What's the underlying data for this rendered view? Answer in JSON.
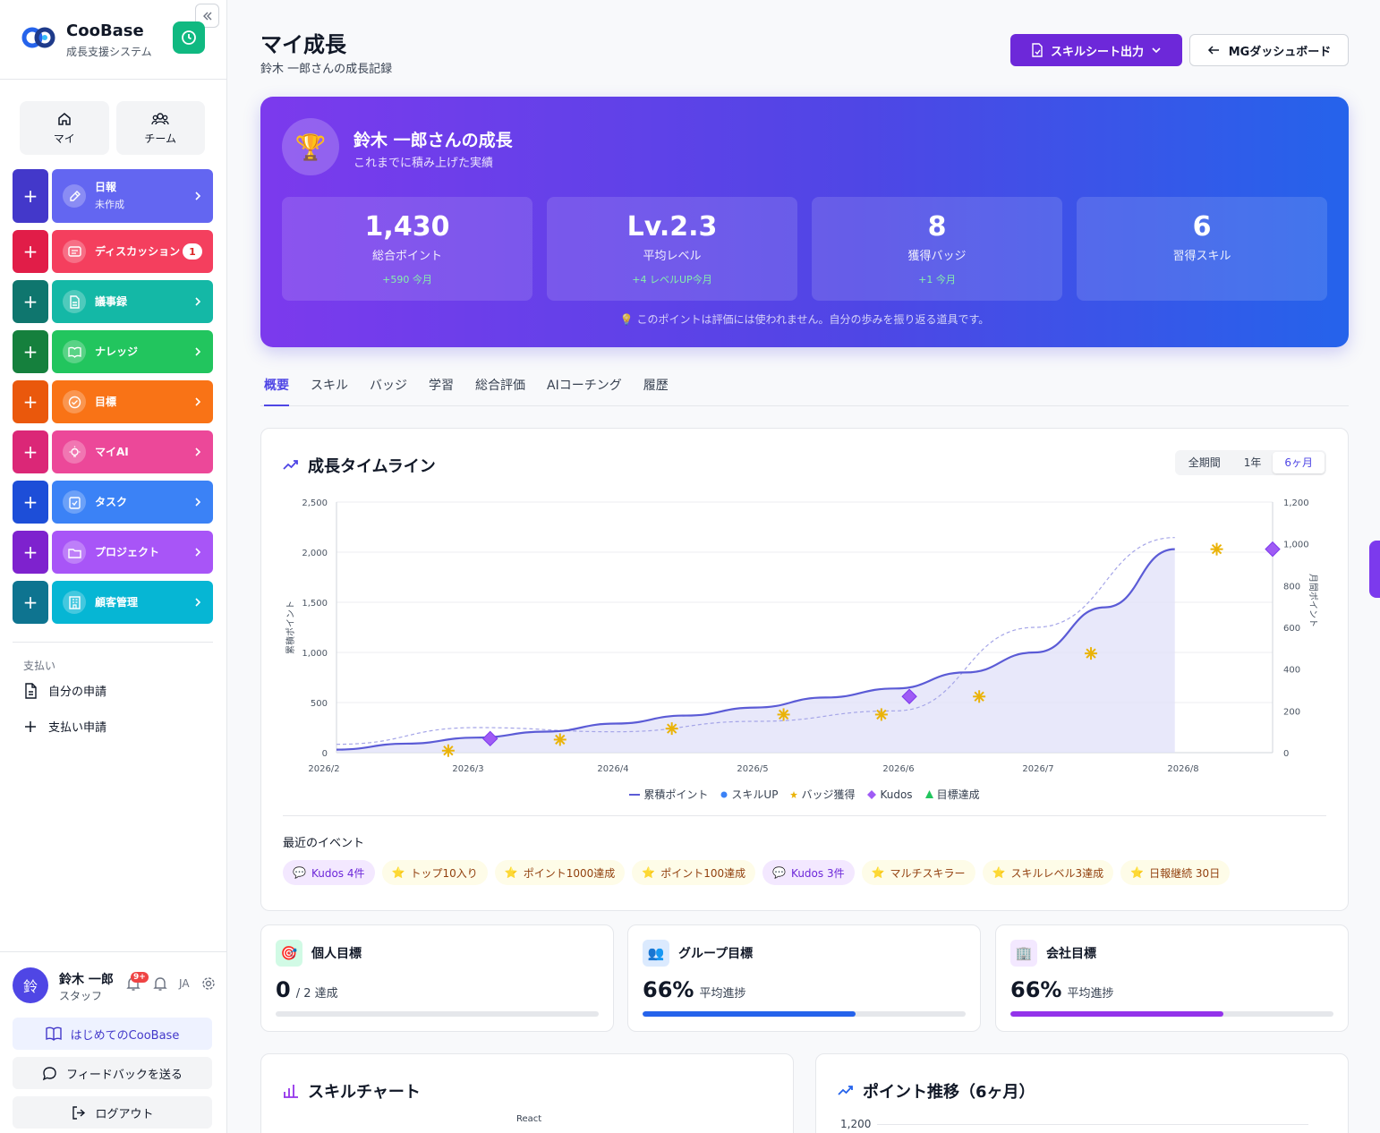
{
  "brand": {
    "name": "CooBase",
    "subtitle": "成長支援システム"
  },
  "sidebar": {
    "modes": [
      {
        "label": "マイ"
      },
      {
        "label": "チーム"
      }
    ],
    "nav": [
      {
        "label": "日報",
        "sub": "未作成",
        "color": "#6366f1",
        "plus_color": "#4338ca"
      },
      {
        "label": "ディスカッション",
        "badge": "1",
        "color": "#f43f5e",
        "plus_color": "#e11d48"
      },
      {
        "label": "議事録",
        "color": "#14b8a6",
        "plus_color": "#0f766e"
      },
      {
        "label": "ナレッジ",
        "color": "#22c55e",
        "plus_color": "#15803d"
      },
      {
        "label": "目標",
        "color": "#f97316",
        "plus_color": "#ea580c"
      },
      {
        "label": "マイAI",
        "color": "#ec4899",
        "plus_color": "#db2777"
      },
      {
        "label": "タスク",
        "color": "#3b82f6",
        "plus_color": "#1d4ed8"
      },
      {
        "label": "プロジェクト",
        "color": "#a855f7",
        "plus_color": "#7e22ce"
      },
      {
        "label": "顧客管理",
        "color": "#06b6d4",
        "plus_color": "#0e7490"
      }
    ],
    "payments": {
      "label": "支払い",
      "items": [
        {
          "label": "自分の申請"
        },
        {
          "label": "支払い申請"
        }
      ]
    },
    "user": {
      "avatar": "鈴",
      "name": "鈴木 一郎",
      "role": "スタッフ",
      "notifications": "9+",
      "lang": "JA"
    },
    "buttons": {
      "intro": "はじめてのCooBase",
      "feedback": "フィードバックを送る",
      "logout": "ログアウト"
    }
  },
  "header": {
    "title": "マイ成長",
    "subtitle": "鈴木 一郎さんの成長記録",
    "skill_sheet_button": "スキルシート出力",
    "mg_button": "MGダッシュボード"
  },
  "hero": {
    "title": "鈴木 一郎さんの成長",
    "subtitle": "これまでに積み上げた実績",
    "stats": [
      {
        "value": "1,430",
        "label": "総合ポイント",
        "delta": "+590 今月"
      },
      {
        "value": "Lv.2.3",
        "label": "平均レベル",
        "delta": "+4 レベルUP今月"
      },
      {
        "value": "8",
        "label": "獲得バッジ",
        "delta": "+1 今月"
      },
      {
        "value": "6",
        "label": "習得スキル",
        "delta": ""
      }
    ],
    "note": "💡 このポイントは評価には使われません。自分の歩みを振り返る道具です。"
  },
  "tabs": [
    "概要",
    "スキル",
    "バッジ",
    "学習",
    "総合評価",
    "AIコーチング",
    "履歴"
  ],
  "timeline": {
    "title": "成長タイムライン",
    "ranges": [
      "全期間",
      "1年",
      "6ヶ月"
    ],
    "active_range": "6ヶ月",
    "events_title": "最近のイベント",
    "events": [
      {
        "icon": "💬",
        "label": "Kudos 4件",
        "kind": "purple"
      },
      {
        "icon": "⭐",
        "label": "トップ10入り",
        "kind": "yellow"
      },
      {
        "icon": "⭐",
        "label": "ポイント1000達成",
        "kind": "yellow"
      },
      {
        "icon": "⭐",
        "label": "ポイント100達成",
        "kind": "yellow"
      },
      {
        "icon": "💬",
        "label": "Kudos 3件",
        "kind": "purple"
      },
      {
        "icon": "⭐",
        "label": "マルチスキラー",
        "kind": "yellow"
      },
      {
        "icon": "⭐",
        "label": "スキルレベル3達成",
        "kind": "yellow"
      },
      {
        "icon": "⭐",
        "label": "日報継続 30日",
        "kind": "yellow"
      }
    ]
  },
  "chart_data": {
    "type": "area",
    "ylabel": "累積ポイント",
    "y2label": "月間ポイント",
    "ylim": [
      0,
      2500
    ],
    "y2lim": [
      0,
      1200
    ],
    "yticks": [
      "0",
      "500",
      "1,000",
      "1,500",
      "2,000",
      "2,500"
    ],
    "y2ticks": [
      "0",
      "200",
      "400",
      "600",
      "800",
      "1,000",
      "1,200"
    ],
    "x_ticks": [
      "2026/2",
      "2026/3",
      "2026/4",
      "2026/5",
      "2026/6",
      "2026/7",
      "2026/8"
    ],
    "grid": true,
    "legend": "bottom",
    "series": [
      {
        "name": "累積ポイント",
        "x": [
          2.0,
          2.5,
          3.0,
          3.5,
          4.0,
          4.5,
          5.0,
          5.5,
          6.0,
          6.5,
          7.0,
          7.5,
          8.0
        ],
        "values": [
          30,
          90,
          150,
          210,
          290,
          370,
          450,
          550,
          640,
          800,
          1000,
          1450,
          2030
        ]
      },
      {
        "name": "月間ポイント",
        "x": [
          2.0,
          3.0,
          4.0,
          5.0,
          6.0,
          7.0,
          8.0
        ],
        "values": [
          40,
          120,
          100,
          150,
          200,
          600,
          1030
        ]
      },
      {
        "name": "スキルUP",
        "x": [],
        "values": []
      },
      {
        "name": "バッジ獲得",
        "x": [
          2.8,
          3.6,
          4.4,
          5.2,
          5.9,
          6.6,
          7.4,
          8.3
        ],
        "values": [
          20,
          130,
          240,
          380,
          380,
          560,
          990,
          2030
        ]
      },
      {
        "name": "Kudos",
        "x": [
          3.1,
          6.1,
          8.7
        ],
        "values": [
          140,
          560,
          2030
        ]
      },
      {
        "name": "目標達成",
        "x": [],
        "values": []
      }
    ],
    "legend_markers": {
      "累積ポイント": "line",
      "スキルUP": "dot",
      "バッジ獲得": "star",
      "Kudos": "diamond",
      "目標達成": "triangle"
    },
    "colors": {
      "累積ポイント": "#5b5bd6",
      "スキルUP": "#3b82f6",
      "バッジ獲得": "#eab308",
      "Kudos": "#9f5bf5",
      "目標達成": "#22c55e"
    }
  },
  "goals": [
    {
      "title": "個人目標",
      "icon": "🎯",
      "value": "0",
      "suffix": "/ 2 達成",
      "progress": 0,
      "color": "#10b981",
      "icon_bg": "#d1fae5"
    },
    {
      "title": "グループ目標",
      "icon": "👥",
      "value": "66%",
      "suffix": "平均進捗",
      "progress": 0.66,
      "color": "#2563eb",
      "icon_bg": "#dbeafe"
    },
    {
      "title": "会社目標",
      "icon": "🏢",
      "value": "66%",
      "suffix": "平均進捗",
      "progress": 0.66,
      "color": "#9333ea",
      "icon_bg": "#f3e8ff"
    }
  ],
  "bottom_cards": {
    "skill_chart": {
      "title": "スキルチャート",
      "first_axis": "React"
    },
    "points_trend": {
      "title": "ポイント推移（6ヶ月）",
      "first_tick": "1,200"
    }
  }
}
